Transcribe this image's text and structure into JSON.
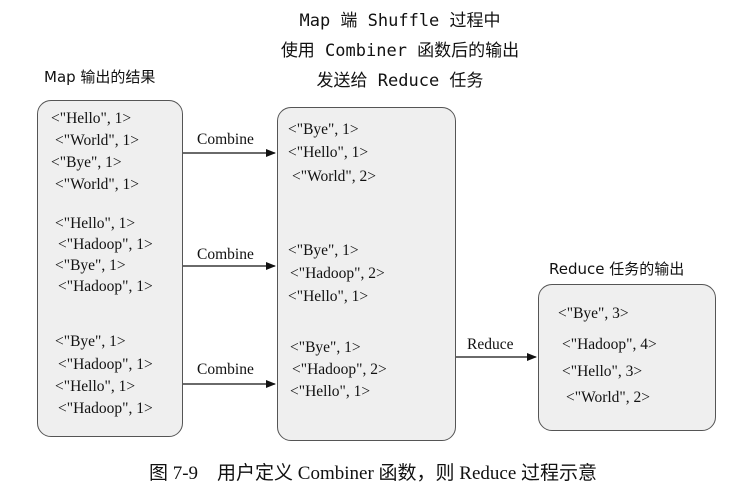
{
  "header": {
    "title_lines": [
      "Map 端 Shuffle 过程中",
      "使用 Combiner 函数后的输出",
      "发送给 Reduce 任务"
    ]
  },
  "map_output": {
    "label": "Map 输出的结果",
    "groups": [
      [
        "<\"Hello\", 1>",
        "<\"World\", 1>",
        "<\"Bye\", 1>",
        "<\"World\", 1>"
      ],
      [
        "<\"Hello\", 1>",
        "<\"Hadoop\", 1>",
        "<\"Bye\", 1>",
        "<\"Hadoop\", 1>"
      ],
      [
        "<\"Bye\", 1>",
        "<\"Hadoop\", 1>",
        "<\"Hello\", 1>",
        "<\"Hadoop\", 1>"
      ]
    ]
  },
  "combine_labels": [
    "Combine",
    "Combine",
    "Combine"
  ],
  "combiner_output": {
    "groups": [
      [
        "<\"Bye\", 1>",
        "<\"Hello\", 1>",
        "<\"World\", 2>"
      ],
      [
        "<\"Bye\", 1>",
        "<\"Hadoop\", 2>",
        "<\"Hello\", 1>"
      ],
      [
        "<\"Bye\", 1>",
        "<\"Hadoop\", 2>",
        "<\"Hello\", 1>"
      ]
    ]
  },
  "reduce_label": "Reduce",
  "reduce_output": {
    "label": "Reduce 任务的输出",
    "items": [
      "<\"Bye\", 3>",
      "<\"Hadoop\", 4>",
      "<\"Hello\", 3>",
      "<\"World\", 2>"
    ]
  },
  "caption": "图 7-9　用户定义 Combiner 函数，则 Reduce 过程示意"
}
